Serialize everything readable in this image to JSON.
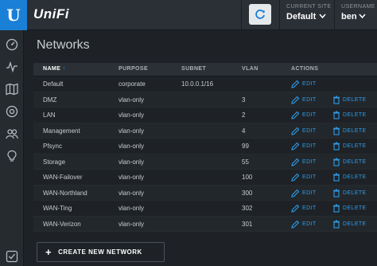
{
  "app": {
    "brand": "UniFi",
    "logo_letter": "U"
  },
  "header": {
    "site_label": "CURRENT SITE",
    "site_value": "Default",
    "user_label": "USERNAME",
    "user_value": "ben"
  },
  "sidebar": {
    "items": [
      {
        "icon": "dashboard-icon"
      },
      {
        "icon": "statistics-icon"
      },
      {
        "icon": "map-icon"
      },
      {
        "icon": "devices-icon"
      },
      {
        "icon": "clients-icon"
      },
      {
        "icon": "insights-icon"
      },
      {
        "icon": "settings-icon"
      }
    ]
  },
  "page": {
    "title": "Networks"
  },
  "table": {
    "columns": [
      "NAME",
      "PURPOSE",
      "SUBNET",
      "VLAN",
      "ACTIONS"
    ],
    "sort_indicator": "↑",
    "edit_label": "EDIT",
    "delete_label": "DELETE",
    "rows": [
      {
        "name": "Default",
        "purpose": "corporate",
        "subnet": "10.0.0.1/16",
        "vlan": "",
        "deletable": false
      },
      {
        "name": "DMZ",
        "purpose": "vlan-only",
        "subnet": "",
        "vlan": "3",
        "deletable": true
      },
      {
        "name": "LAN",
        "purpose": "vlan-only",
        "subnet": "",
        "vlan": "2",
        "deletable": true
      },
      {
        "name": "Management",
        "purpose": "vlan-only",
        "subnet": "",
        "vlan": "4",
        "deletable": true
      },
      {
        "name": "Pfsync",
        "purpose": "vlan-only",
        "subnet": "",
        "vlan": "99",
        "deletable": true
      },
      {
        "name": "Storage",
        "purpose": "vlan-only",
        "subnet": "",
        "vlan": "55",
        "deletable": true
      },
      {
        "name": "WAN-Failover",
        "purpose": "vlan-only",
        "subnet": "",
        "vlan": "100",
        "deletable": true
      },
      {
        "name": "WAN-Northland",
        "purpose": "vlan-only",
        "subnet": "",
        "vlan": "300",
        "deletable": true
      },
      {
        "name": "WAN-Ting",
        "purpose": "vlan-only",
        "subnet": "",
        "vlan": "302",
        "deletable": true
      },
      {
        "name": "WAN-Verizon",
        "purpose": "vlan-only",
        "subnet": "",
        "vlan": "301",
        "deletable": true
      }
    ]
  },
  "create_button": {
    "label": "CREATE NEW NETWORK",
    "icon": "plus-icon"
  },
  "colors": {
    "accent": "#2f9be8",
    "brand": "#1a7fd6",
    "background": "#1e2226"
  }
}
